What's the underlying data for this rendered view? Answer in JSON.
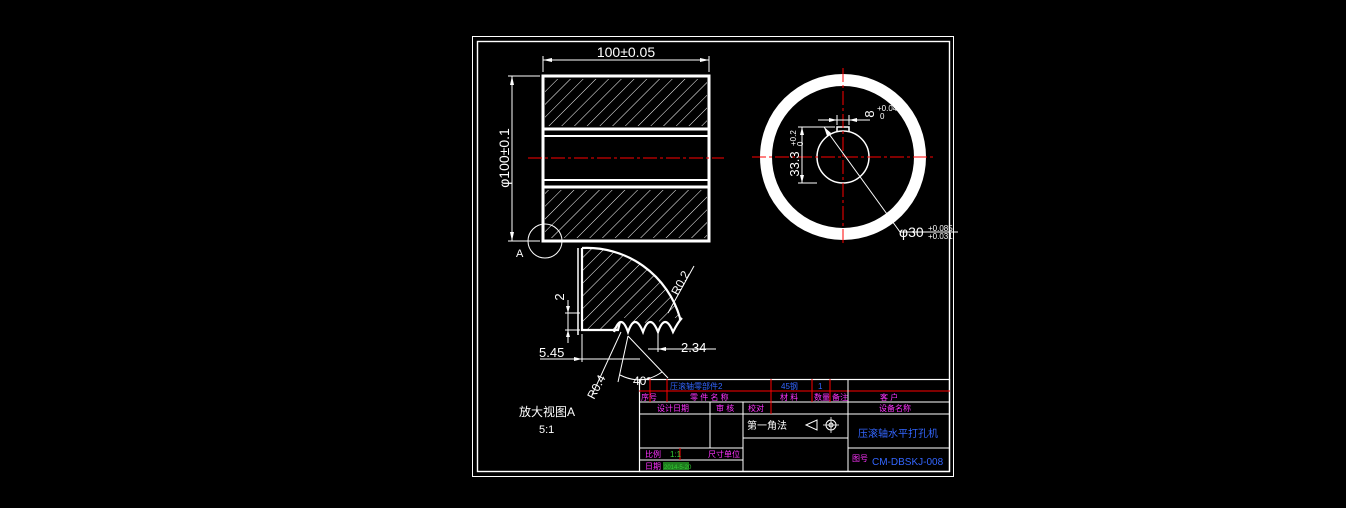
{
  "colors": {
    "background": "#000000",
    "line": "#ffffff",
    "centerline": "#ff0000",
    "table_grid": "#ff0000",
    "table_text_red": "#ff3333",
    "table_text_blue": "#3366ff",
    "table_text_green": "#33cc33",
    "table_text_magenta": "#ff33ff"
  },
  "front_view": {
    "dim_width": "100±0.05",
    "dim_diameter": "φ100±0.1",
    "detail_marker": "A"
  },
  "side_view": {
    "dim_keyway_width": "8",
    "dim_keyway_width_tol": "+0.04",
    "dim_keyway_width_tol2": "0",
    "dim_keyway_depth": "33.3",
    "dim_keyway_depth_tol": "+0.2",
    "dim_keyway_depth_tol2": "0",
    "dim_bore": "φ30",
    "dim_bore_tol_upper": "+0.085",
    "dim_bore_tol_lower": "+0.031"
  },
  "detail_view": {
    "dim_height": "2",
    "dim_offset": "5.45",
    "dim_pitch": "2.34",
    "dim_radius_top": "R0.2",
    "dim_radius_bottom": "R0.4",
    "dim_angle": "40°",
    "caption": "放大视图A",
    "scale": "5:1"
  },
  "title_block": {
    "row1_name": "压滚轴零部件2",
    "row1_material": "45钢",
    "row1_qty": "1",
    "hdr_no": "序号",
    "hdr_name": "零 件 名 称",
    "hdr_material": "材  料",
    "hdr_qty": "数量",
    "hdr_note": "备注",
    "hdr_client": "客    户",
    "lbl_design": "设计日期",
    "lbl_review": "审 核",
    "lbl_check": "校对",
    "lbl_projection": "第一角法",
    "lbl_equipment": "设备名称",
    "equipment_name": "压滚轴水平打孔机",
    "lbl_scale": "比例",
    "scale_value": "1:1",
    "lbl_unit": "尺寸单位",
    "lbl_date": "日期",
    "date_value": "2014-5-20",
    "lbl_drawing_no": "图号",
    "drawing_no": "CM-DBSKJ-008"
  }
}
